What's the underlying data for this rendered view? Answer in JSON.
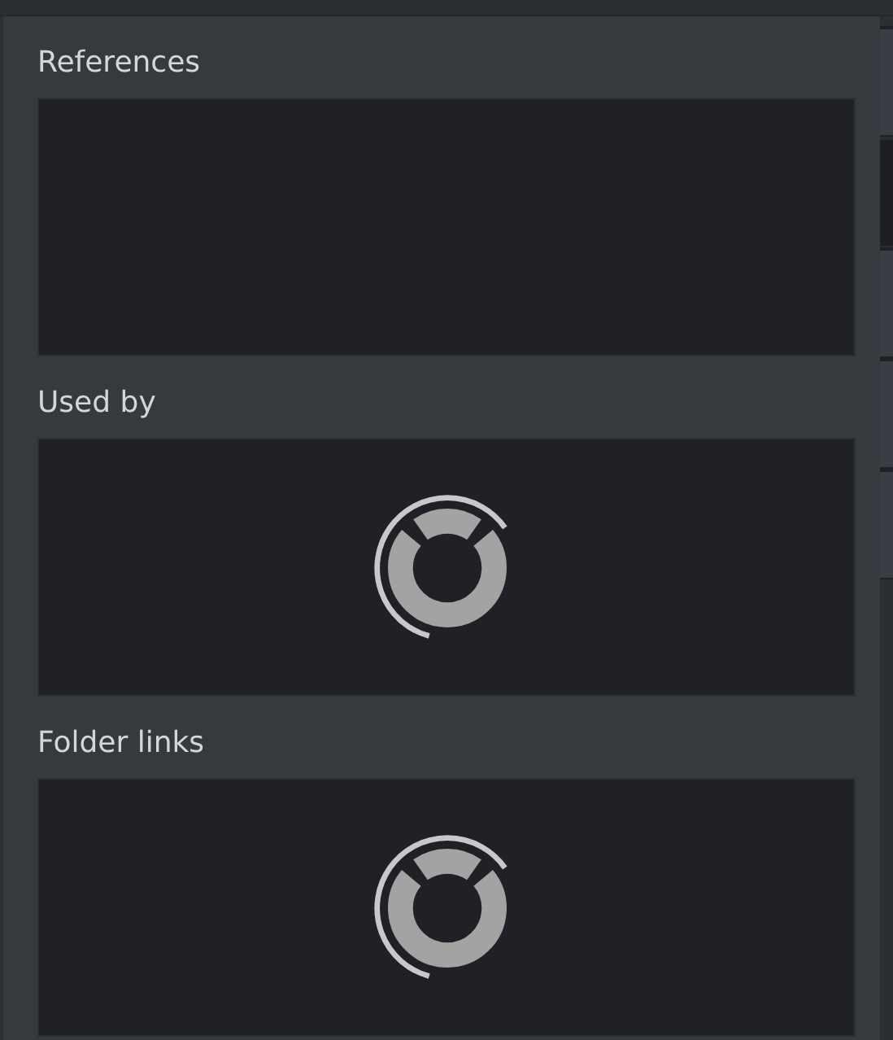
{
  "sections": [
    {
      "label": "References",
      "loading": false
    },
    {
      "label": "Used by",
      "loading": true
    },
    {
      "label": "Folder links",
      "loading": true
    }
  ]
}
